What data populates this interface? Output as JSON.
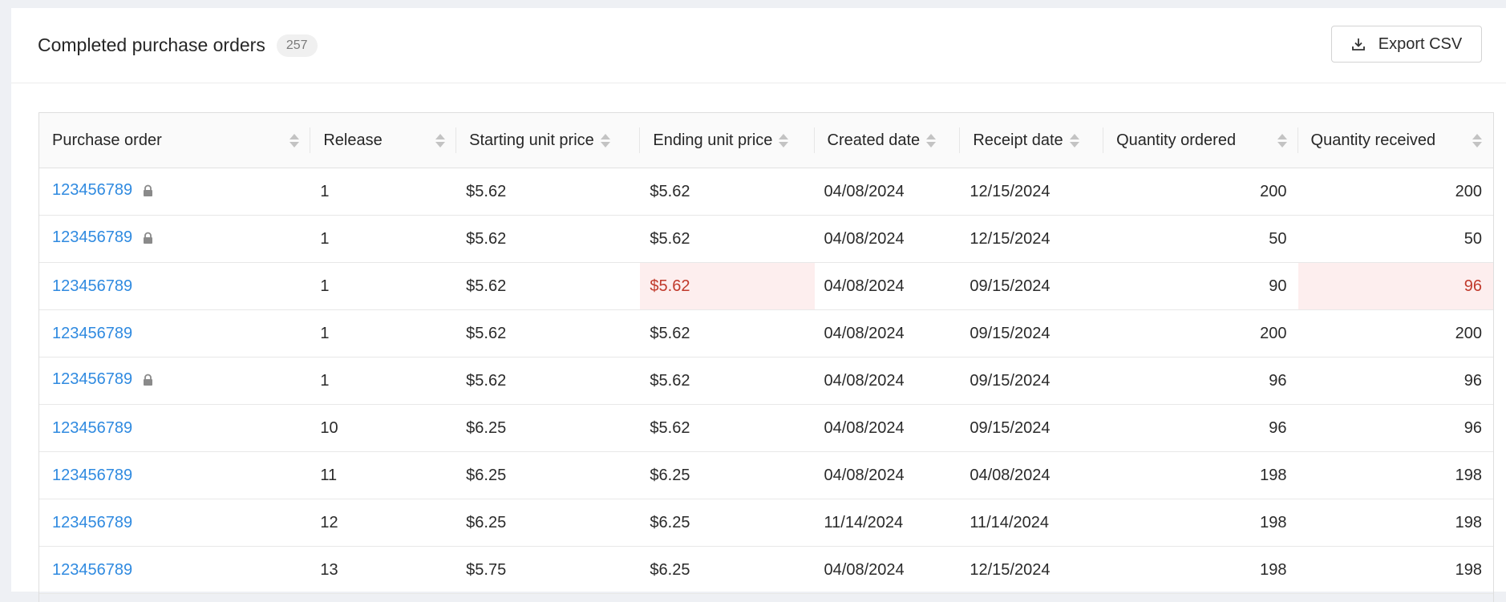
{
  "header": {
    "title": "Completed purchase orders",
    "count": "257",
    "export_label": "Export CSV"
  },
  "columns": [
    "Purchase order",
    "Release",
    "Starting unit price",
    "Ending unit price",
    "Created date",
    "Receipt date",
    "Quantity ordered",
    "Quantity received"
  ],
  "rows": [
    {
      "po": "123456789",
      "locked": true,
      "release": "1",
      "start_price": "$5.62",
      "end_price": "$5.62",
      "created": "04/08/2024",
      "receipt": "12/15/2024",
      "qty_ordered": "200",
      "qty_received": "200",
      "end_price_flag": false,
      "qty_received_flag": false
    },
    {
      "po": "123456789",
      "locked": true,
      "release": "1",
      "start_price": "$5.62",
      "end_price": "$5.62",
      "created": "04/08/2024",
      "receipt": "12/15/2024",
      "qty_ordered": "50",
      "qty_received": "50",
      "end_price_flag": false,
      "qty_received_flag": false
    },
    {
      "po": "123456789",
      "locked": false,
      "release": "1",
      "start_price": "$5.62",
      "end_price": "$5.62",
      "created": "04/08/2024",
      "receipt": "09/15/2024",
      "qty_ordered": "90",
      "qty_received": "96",
      "end_price_flag": true,
      "qty_received_flag": true
    },
    {
      "po": "123456789",
      "locked": false,
      "release": "1",
      "start_price": "$5.62",
      "end_price": "$5.62",
      "created": "04/08/2024",
      "receipt": "09/15/2024",
      "qty_ordered": "200",
      "qty_received": "200",
      "end_price_flag": false,
      "qty_received_flag": false
    },
    {
      "po": "123456789",
      "locked": true,
      "release": "1",
      "start_price": "$5.62",
      "end_price": "$5.62",
      "created": "04/08/2024",
      "receipt": "09/15/2024",
      "qty_ordered": "96",
      "qty_received": "96",
      "end_price_flag": false,
      "qty_received_flag": false
    },
    {
      "po": "123456789",
      "locked": false,
      "release": "10",
      "start_price": "$6.25",
      "end_price": "$5.62",
      "created": "04/08/2024",
      "receipt": "09/15/2024",
      "qty_ordered": "96",
      "qty_received": "96",
      "end_price_flag": false,
      "qty_received_flag": false
    },
    {
      "po": "123456789",
      "locked": false,
      "release": "11",
      "start_price": "$6.25",
      "end_price": "$6.25",
      "created": "04/08/2024",
      "receipt": "04/08/2024",
      "qty_ordered": "198",
      "qty_received": "198",
      "end_price_flag": false,
      "qty_received_flag": false
    },
    {
      "po": "123456789",
      "locked": false,
      "release": "12",
      "start_price": "$6.25",
      "end_price": "$6.25",
      "created": "11/14/2024",
      "receipt": "11/14/2024",
      "qty_ordered": "198",
      "qty_received": "198",
      "end_price_flag": false,
      "qty_received_flag": false
    },
    {
      "po": "123456789",
      "locked": false,
      "release": "13",
      "start_price": "$5.75",
      "end_price": "$6.25",
      "created": "04/08/2024",
      "receipt": "12/15/2024",
      "qty_ordered": "198",
      "qty_received": "198",
      "end_price_flag": false,
      "qty_received_flag": false
    }
  ],
  "colors": {
    "link": "#2f8ae0",
    "warning_bg": "#fdeeee",
    "warning_text": "#c0392b"
  }
}
